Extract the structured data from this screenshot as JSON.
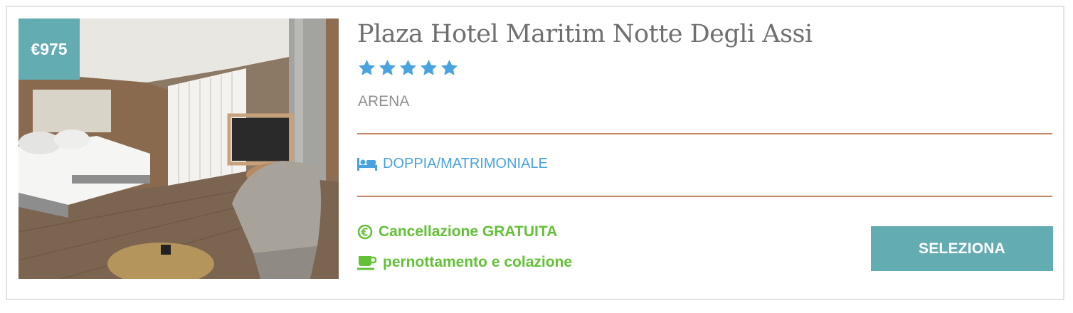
{
  "hotel": {
    "price": "€975",
    "name": "Plaza Hotel Maritim Notte Degli Assi",
    "stars": 5,
    "location": "ARENA",
    "room_type": "DOPPIA/MATRIMONIALE",
    "cancellation": "Cancellazione GRATUITA",
    "board": "pernottamento e colazione",
    "select_label": "SELEZIONA"
  },
  "colors": {
    "accent": "#63acb1",
    "star": "#4aa3df",
    "room": "#4aa3df",
    "feature": "#62c137",
    "divider": "#c1886a"
  },
  "icons": [
    "bed-icon",
    "euro-circle-icon",
    "coffee-cup-icon",
    "star-icon"
  ]
}
